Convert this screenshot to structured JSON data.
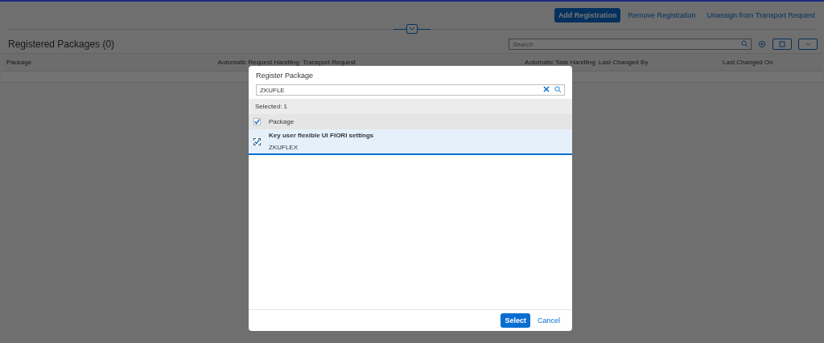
{
  "toolbar": {
    "buttons": [
      {
        "label": "Add Registration",
        "kind": "primary"
      },
      {
        "label": "Remove Registration",
        "kind": "ghost"
      },
      {
        "label": "Unassign from Transport Request",
        "kind": "ghost"
      }
    ]
  },
  "table": {
    "title": "Registered Packages (0)",
    "search": {
      "placeholder": "Search"
    },
    "columns": [
      {
        "label": "Package",
        "kind": "text"
      },
      {
        "label": "Automatic Request Handling",
        "kind": "flag"
      },
      {
        "label": "Transport Request",
        "kind": "text"
      },
      {
        "label": "Automatic Task Handling",
        "kind": "flag"
      },
      {
        "label": "Last Changed By",
        "kind": "text"
      },
      {
        "label": "Last Changed On",
        "kind": "text"
      }
    ]
  },
  "dialog": {
    "title": "Register Package",
    "search": {
      "value": "ZKUFLE"
    },
    "selected_count": "Selected: 1",
    "header": {
      "label": "Package",
      "checked": true
    },
    "items": [
      {
        "title": "Key user flexible UI FIORI settings",
        "subtitle": "ZKUFLEX",
        "checked": true,
        "selected": true
      }
    ],
    "buttons": [
      {
        "label": "Select",
        "kind": "primary"
      },
      {
        "label": "Cancel",
        "kind": "ghost"
      }
    ]
  }
}
